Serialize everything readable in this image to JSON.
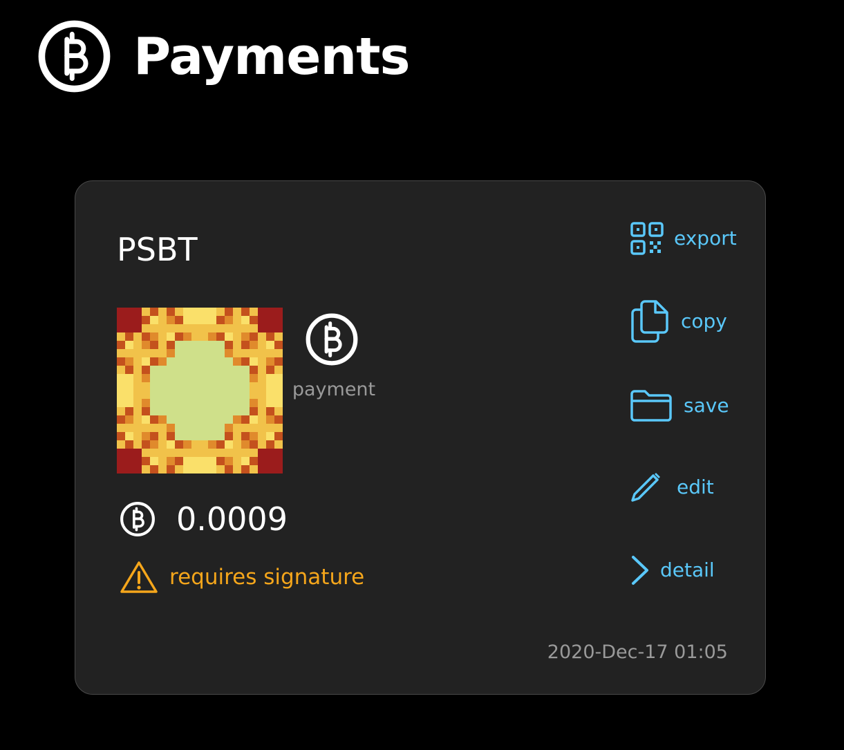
{
  "header": {
    "title": "Payments",
    "icon": "bitcoin-circle-icon"
  },
  "card": {
    "title": "PSBT",
    "type_label": "payment",
    "type_icon": "bitcoin-circle-icon",
    "amount": "0.0009",
    "amount_icon": "bitcoin-circle-icon",
    "status": "requires signature",
    "status_icon": "warning-triangle-icon",
    "timestamp": "2020-Dec-17 01:05",
    "actions": {
      "export": "export",
      "copy": "copy",
      "save": "save",
      "edit": "edit",
      "detail": "detail"
    }
  },
  "colors": {
    "background": "#000000",
    "card_background": "#222222",
    "card_border": "#4a4a4a",
    "accent": "#5ac8fa",
    "warning": "#f5a61b",
    "muted_text": "#9a9a9a",
    "identicon_palette": [
      "#9b1c1c",
      "#c4511d",
      "#e08a2c",
      "#f1c24a",
      "#fae06a",
      "#cfe08a"
    ]
  }
}
